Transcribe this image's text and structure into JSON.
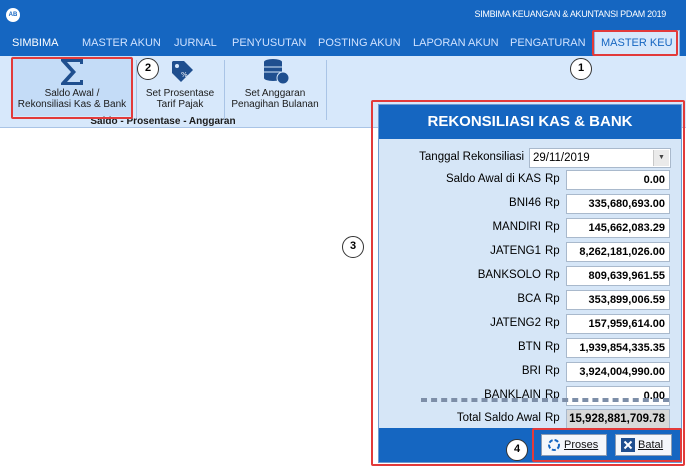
{
  "app": {
    "icon_label": "AB",
    "window_title": "SIMBIMA KEUANGAN & AKUNTANSI PDAM 2019"
  },
  "menu": {
    "items": [
      {
        "label": "SIMBIMA"
      },
      {
        "label": "MASTER AKUN"
      },
      {
        "label": "JURNAL"
      },
      {
        "label": "PENYUSUTAN"
      },
      {
        "label": "POSTING AKUN"
      },
      {
        "label": "LAPORAN AKUN"
      },
      {
        "label": "PENGATURAN"
      },
      {
        "label": "MASTER KEU"
      }
    ],
    "active_index": 7
  },
  "ribbon": {
    "buttons": [
      {
        "label_line1": "Saldo Awal /",
        "label_line2": "Rekonsiliasi Kas & Bank",
        "icon": "sigma-icon"
      },
      {
        "label_line1": "Set Prosentase",
        "label_line2": "Tarif Pajak",
        "icon": "tag-icon"
      },
      {
        "label_line1": "Set Anggaran",
        "label_line2": "Penagihan Bulanan",
        "icon": "coins-icon"
      }
    ],
    "group_label": "Saldo - Prosentase - Anggaran"
  },
  "callouts": [
    "1",
    "2",
    "3",
    "4"
  ],
  "dialog": {
    "title": "REKONSILIASI KAS & BANK",
    "date_label": "Tanggal Rekonsiliasi",
    "date_value": "29/11/2019",
    "currency": "Rp",
    "rows": [
      {
        "label": "Saldo Awal di KAS",
        "value": "0.00"
      },
      {
        "label": "BNI46",
        "value": "335,680,693.00"
      },
      {
        "label": "MANDIRI",
        "value": "145,662,083.29"
      },
      {
        "label": "JATENG1",
        "value": "8,262,181,026.00"
      },
      {
        "label": "BANKSOLO",
        "value": "809,639,961.55"
      },
      {
        "label": "BCA",
        "value": "353,899,006.59"
      },
      {
        "label": "JATENG2",
        "value": "157,959,614.00"
      },
      {
        "label": "BTN",
        "value": "1,939,854,335.35"
      },
      {
        "label": "BRI",
        "value": "3,924,004,990.00"
      },
      {
        "label": "BANKLAIN",
        "value": "0.00"
      }
    ],
    "total_label": "Total Saldo Awal",
    "total_value": "15,928,881,709.78",
    "buttons": {
      "proses_label": "Proses",
      "batal_label": "Batal"
    }
  },
  "colors": {
    "primary": "#1566c1",
    "ribbon": "#d7e8fb",
    "dialog_bg": "#d6e6f7",
    "annotation": "#e23a3a"
  }
}
